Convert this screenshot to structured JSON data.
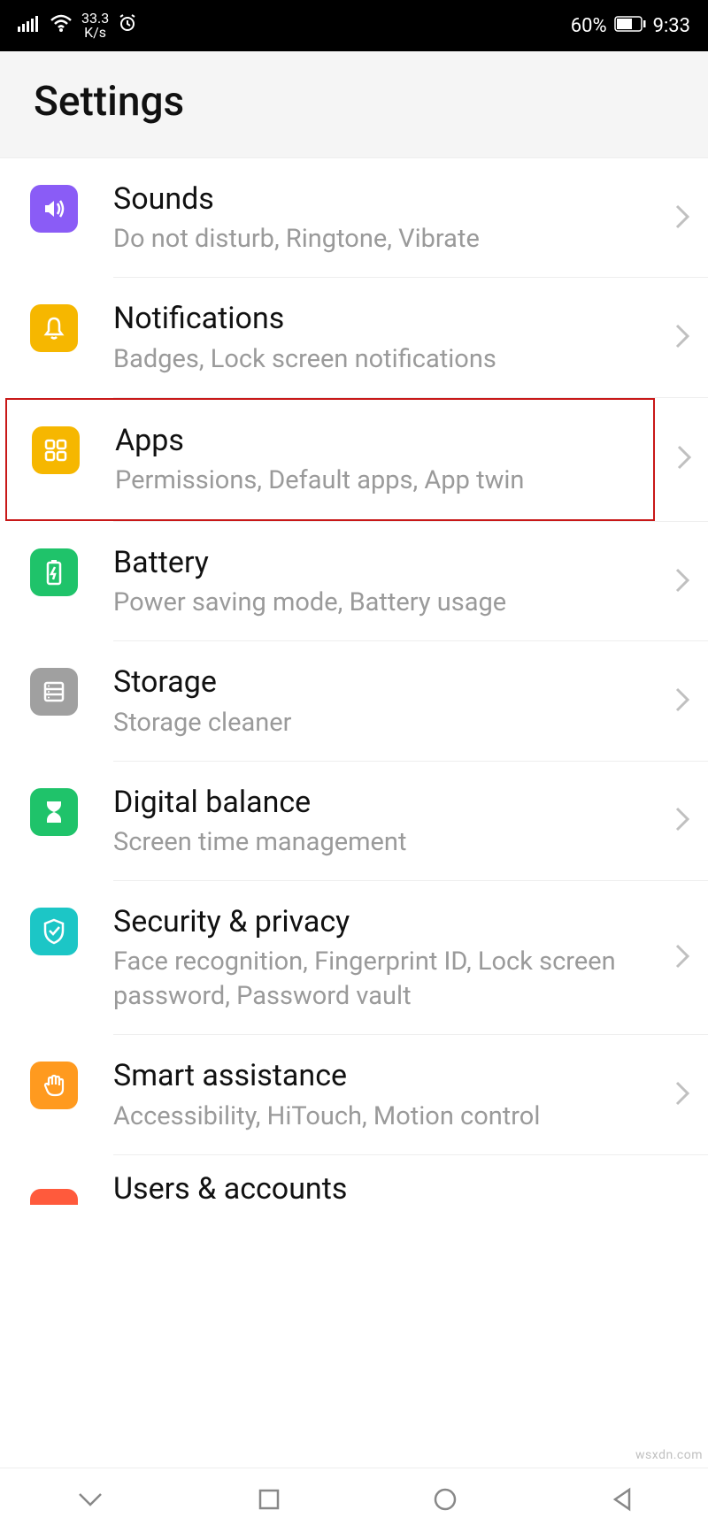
{
  "statusbar": {
    "net_speed_top": "33.3",
    "net_speed_bot": "K/s",
    "battery_pct": "60%",
    "time": "9:33"
  },
  "header": {
    "title": "Settings"
  },
  "items": [
    {
      "id": "sounds",
      "title": "Sounds",
      "sub": "Do not disturb, Ringtone, Vibrate",
      "color": "#8a5cf6",
      "highlight": false
    },
    {
      "id": "notifications",
      "title": "Notifications",
      "sub": "Badges, Lock screen notifications",
      "color": "#f6b700",
      "highlight": false
    },
    {
      "id": "apps",
      "title": "Apps",
      "sub": "Permissions, Default apps, App twin",
      "color": "#f6b700",
      "highlight": true
    },
    {
      "id": "battery",
      "title": "Battery",
      "sub": "Power saving mode, Battery usage",
      "color": "#1fc36a",
      "highlight": false
    },
    {
      "id": "storage",
      "title": "Storage",
      "sub": "Storage cleaner",
      "color": "#a0a0a0",
      "highlight": false
    },
    {
      "id": "digital-balance",
      "title": "Digital balance",
      "sub": "Screen time management",
      "color": "#1fc36a",
      "highlight": false
    },
    {
      "id": "security",
      "title": "Security & privacy",
      "sub": "Face recognition, Fingerprint ID, Lock screen password, Password vault",
      "color": "#1cc6c6",
      "highlight": false
    },
    {
      "id": "smart-assistance",
      "title": "Smart assistance",
      "sub": "Accessibility, HiTouch, Motion control",
      "color": "#ff9a1f",
      "highlight": false
    },
    {
      "id": "users",
      "title": "Users & accounts",
      "sub": "",
      "color": "#ff5a3c",
      "highlight": false
    }
  ],
  "watermark": "wsxdn.com"
}
